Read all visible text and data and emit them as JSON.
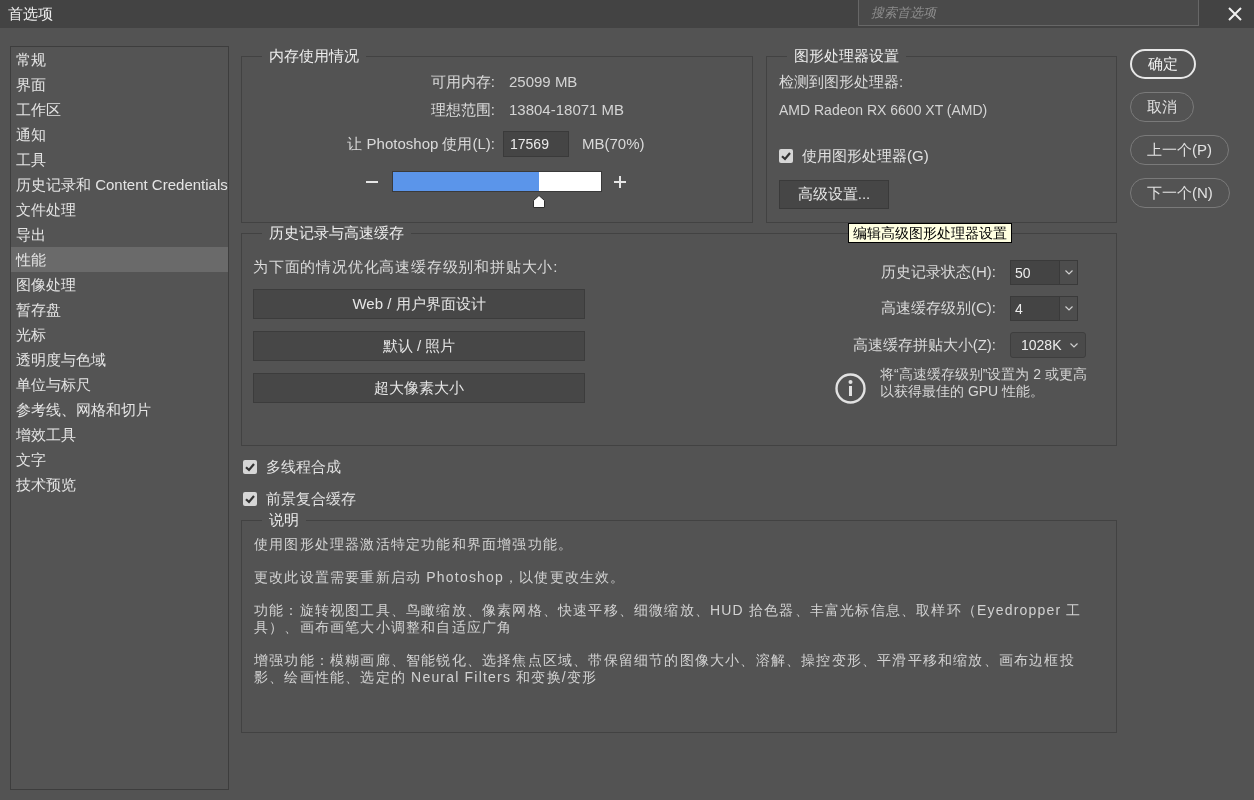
{
  "window": {
    "title": "首选项"
  },
  "search": {
    "placeholder": "搜索首选项"
  },
  "sidebar": {
    "items": [
      {
        "label": "常规",
        "selected": false
      },
      {
        "label": "界面",
        "selected": false
      },
      {
        "label": "工作区",
        "selected": false
      },
      {
        "label": "通知",
        "selected": false
      },
      {
        "label": "工具",
        "selected": false
      },
      {
        "label": "历史记录和 Content Credentials",
        "selected": false
      },
      {
        "label": "文件处理",
        "selected": false
      },
      {
        "label": "导出",
        "selected": false
      },
      {
        "label": "性能",
        "selected": true
      },
      {
        "label": "图像处理",
        "selected": false
      },
      {
        "label": "暂存盘",
        "selected": false
      },
      {
        "label": "光标",
        "selected": false
      },
      {
        "label": "透明度与色域",
        "selected": false
      },
      {
        "label": "单位与标尺",
        "selected": false
      },
      {
        "label": "参考线、网格和切片",
        "selected": false
      },
      {
        "label": "增效工具",
        "selected": false
      },
      {
        "label": "文字",
        "selected": false
      },
      {
        "label": "技术预览",
        "selected": false
      }
    ]
  },
  "memory": {
    "title": "内存使用情况",
    "rows": [
      {
        "label": "可用内存:",
        "value": "25099 MB"
      },
      {
        "label": "理想范围:",
        "value": "13804-18071 MB"
      }
    ],
    "usage": {
      "label": "让 Photoshop 使用(L):",
      "value": "17569",
      "unit": "MB(70%)"
    },
    "level": 0.7
  },
  "gpu": {
    "title": "图形处理器设置",
    "detected_label": "检测到图形处理器:",
    "detected_name": "AMD Radeon RX 6600 XT (AMD)",
    "use_gpu": {
      "label": "使用图形处理器(G)",
      "checked": true
    },
    "advanced_button": "高级设置...",
    "tooltip": "编辑高级图形处理器设置"
  },
  "buttons": [
    {
      "label": "确定",
      "default": true
    },
    {
      "label": "取消",
      "default": false
    },
    {
      "label": "上一个(P)",
      "default": false
    },
    {
      "label": "下一个(N)",
      "default": false
    }
  ],
  "history_cache": {
    "title": "历史记录与高速缓存",
    "prompt": "为下面的情况优化高速缓存级别和拼贴大小:",
    "presets": [
      "Web / 用户界面设计",
      "默认 / 照片",
      "超大像素大小"
    ],
    "settings": [
      {
        "kind": "combo",
        "label": "历史记录状态(H):",
        "value": "50"
      },
      {
        "kind": "combo",
        "label": "高速缓存级别(C):",
        "value": "4"
      },
      {
        "kind": "dropdown",
        "label": "高速缓存拼贴大小(Z):",
        "value": "1028K"
      }
    ],
    "note": "将“高速缓存级别”设置为 2 或更高以获得最佳的 GPU 性能。"
  },
  "options": [
    {
      "label": "多线程合成",
      "checked": true
    },
    {
      "label": "前景复合缓存",
      "checked": true
    }
  ],
  "description": {
    "title": "说明",
    "paragraphs": [
      "使用图形处理器激活特定功能和界面增强功能。",
      "更改此设置需要重新启动 Photoshop，以使更改生效。",
      "功能：旋转视图工具、鸟瞰缩放、像素网格、快速平移、细微缩放、HUD 拾色器、丰富光标信息、取样环（Eyedropper 工具）、画布画笔大小调整和自适应广角",
      "增强功能：模糊画廊、智能锐化、选择焦点区域、带保留细节的图像大小、溶解、操控变形、平滑平移和缩放、画布边框投影、绘画性能、选定的 Neural Filters 和变换/变形"
    ]
  }
}
